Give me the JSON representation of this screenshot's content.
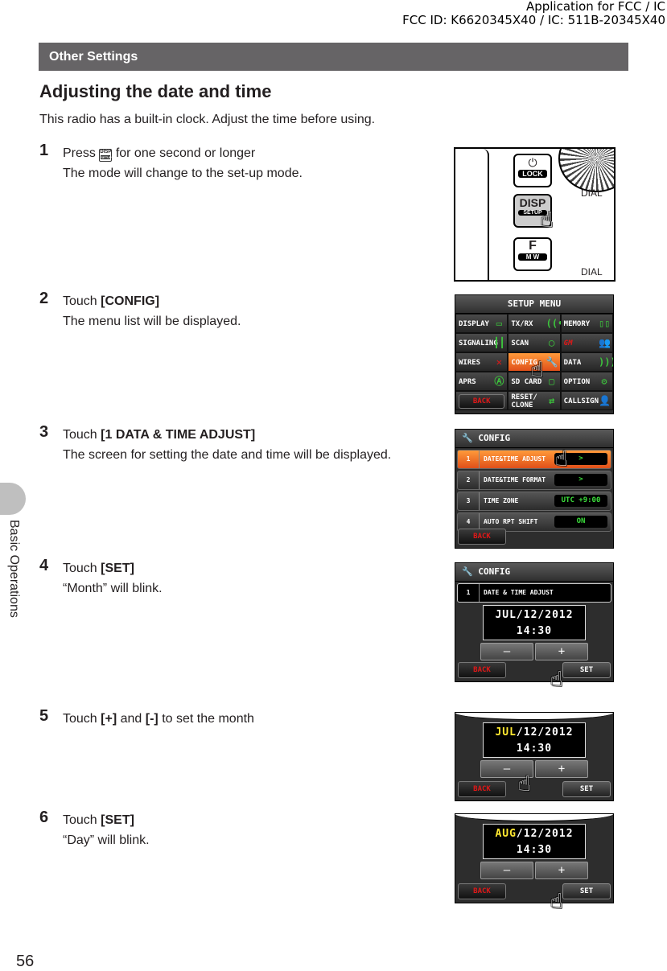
{
  "header": {
    "line1": "Application for FCC / IC",
    "line2": "FCC ID: K6620345X40 / IC: 511B-20345X40"
  },
  "section_title": "Other Settings",
  "heading": "Adjusting the date and time",
  "intro": "This radio has a built-in clock. Adjust the time before using.",
  "side_label": "Basic Operations",
  "page_number": "56",
  "steps": [
    {
      "num": "1",
      "pre": "Press",
      "key": {
        "top": "DISP",
        "bottom": "SETUP"
      },
      "post": "for one second or longer",
      "desc": "The mode will change to the set-up mode."
    },
    {
      "num": "2",
      "pre": "Touch",
      "bold": "[CONFIG]",
      "desc": "The menu list will be displayed."
    },
    {
      "num": "3",
      "pre": "Touch",
      "bold": "[1 DATA & TIME ADJUST]",
      "desc": "The screen for setting the date and time will be displayed."
    },
    {
      "num": "4",
      "pre": "Touch",
      "bold": "[SET]",
      "desc": "“Month” will blink."
    },
    {
      "num": "5",
      "pre": "Touch",
      "bold": "[+]",
      "mid": "and",
      "bold2": "[-]",
      "post": "to set the month"
    },
    {
      "num": "6",
      "pre": "Touch",
      "bold": "[SET]",
      "desc": "“Day” will blink."
    }
  ],
  "panel1": {
    "lock": "LOCK",
    "disp": "DISP",
    "setup": "SETUP",
    "f": "F",
    "mw": "M W",
    "dial1": "DIAL",
    "dial2": "DIAL"
  },
  "panel2": {
    "title": "SETUP MENU",
    "items": [
      "DISPLAY",
      "TX/RX",
      "MEMORY",
      "SIGNALING",
      "SCAN",
      "GM",
      "WIRES",
      "CONFIG",
      "DATA",
      "APRS",
      "SD CARD",
      "OPTION",
      "BACK",
      "RESET/ CLONE",
      "CALLSIGN"
    ]
  },
  "panel3": {
    "title": "CONFIG",
    "rows": [
      {
        "n": "1",
        "label": "DATE&TIME ADJUST",
        "value": ">"
      },
      {
        "n": "2",
        "label": "DATE&TIME FORMAT",
        "value": ">"
      },
      {
        "n": "3",
        "label": "TIME ZONE",
        "value": "UTC +9:00"
      },
      {
        "n": "4",
        "label": "AUTO RPT SHIFT",
        "value": "ON"
      }
    ],
    "back": "BACK"
  },
  "panel4": {
    "title": "CONFIG",
    "row_n": "1",
    "row_label": "DATE & TIME ADJUST",
    "date": "JUL/12/2012",
    "time": "14:30",
    "minus": "—",
    "plus": "+",
    "back": "BACK",
    "set": "SET"
  },
  "panel5": {
    "month": "JUL",
    "date_rest": "/12/2012",
    "time": "14:30",
    "minus": "—",
    "plus": "+",
    "back": "BACK",
    "set": "SET"
  },
  "panel6": {
    "month": "AUG",
    "date_rest": "/12/2012",
    "time": "14:30",
    "minus": "—",
    "plus": "+",
    "back": "BACK",
    "set": "SET"
  }
}
